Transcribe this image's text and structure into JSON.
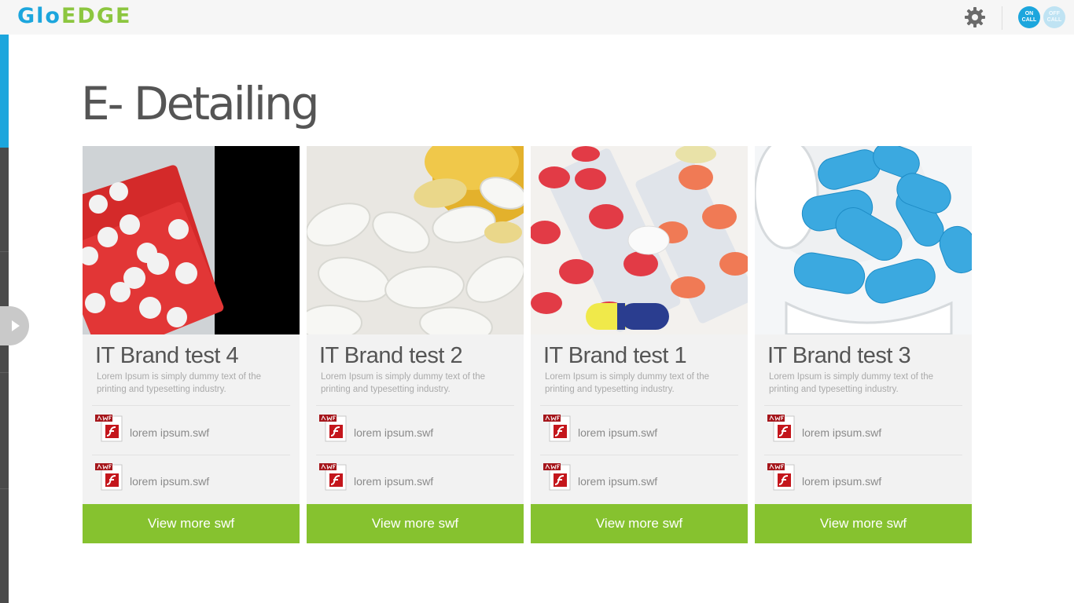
{
  "app": {
    "logo_part1": "Glo",
    "logo_part2": "EDGE",
    "status_on": "ON\nCALL",
    "status_off": "OFF\nCALL"
  },
  "colors": {
    "accent_blue": "#1ca6dd",
    "accent_green": "#86c22f"
  },
  "icons": {
    "settings": "gear-icon",
    "drawer_toggle": "chevron-right-icon",
    "file": "swf-file-icon"
  },
  "page": {
    "title": "E- Detailing"
  },
  "cards": [
    {
      "title": "IT Brand test 4",
      "description": "Lorem Ipsum is simply dummy text of the printing and typesetting industry.",
      "files": [
        "lorem ipsum.swf",
        "lorem ipsum.swf"
      ],
      "button": "View more swf"
    },
    {
      "title": "IT Brand test 2",
      "description": "Lorem Ipsum is simply dummy text of the printing and typesetting industry.",
      "files": [
        "lorem ipsum.swf",
        "lorem ipsum.swf"
      ],
      "button": "View more swf"
    },
    {
      "title": "IT Brand test 1",
      "description": "Lorem Ipsum is simply dummy text of the printing and typesetting industry.",
      "files": [
        "lorem ipsum.swf",
        "lorem ipsum.swf"
      ],
      "button": "View more swf"
    },
    {
      "title": "IT Brand test 3",
      "description": "Lorem Ipsum is simply dummy text of the printing and typesetting industry.",
      "files": [
        "lorem ipsum.swf",
        "lorem ipsum.swf"
      ],
      "button": "View more swf"
    }
  ]
}
